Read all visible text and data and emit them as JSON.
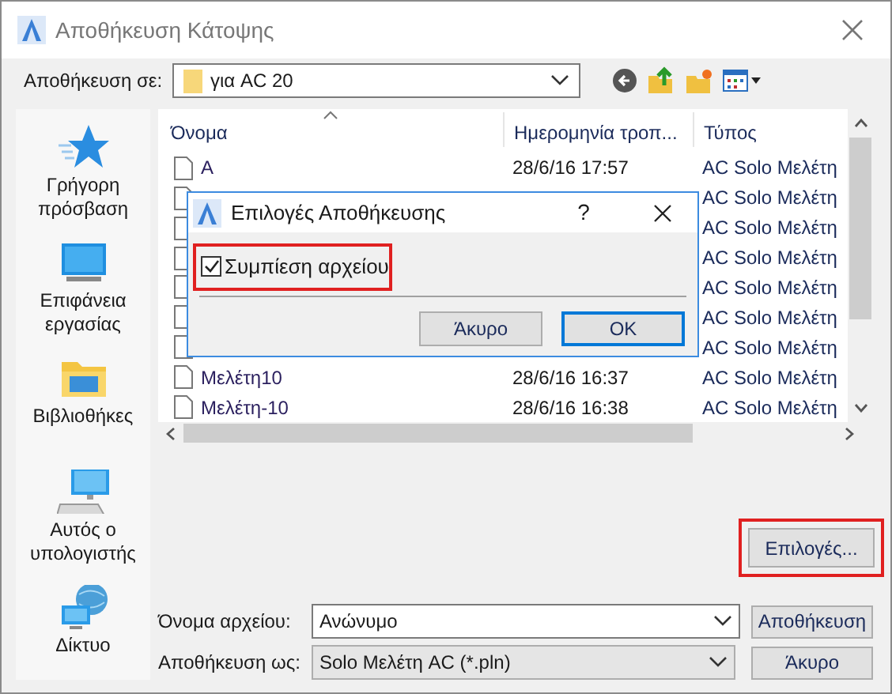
{
  "window": {
    "title": "Αποθήκευση Κάτοψης"
  },
  "location": {
    "label": "Αποθήκευση σε:",
    "value": "για AC 20"
  },
  "sidebar": {
    "items": [
      {
        "label": "Γρήγορη πρόσβαση"
      },
      {
        "label": "Επιφάνεια εργασίας"
      },
      {
        "label": "Βιβλιοθήκες"
      },
      {
        "label": "Αυτός ο υπολογιστής"
      },
      {
        "label": "Δίκτυο"
      }
    ]
  },
  "table": {
    "columns": [
      "Όνομα",
      "Ημερομηνία τροπ...",
      "Τύπος"
    ],
    "rows": [
      {
        "name": "A",
        "date": "28/6/16 17:57",
        "type": "AC Solo Μελέτη"
      },
      {
        "type": "AC Solo Μελέτη"
      },
      {
        "type": "AC Solo Μελέτη"
      },
      {
        "type": "AC Solo Μελέτη"
      },
      {
        "type": "AC Solo Μελέτη"
      },
      {
        "type": "AC Solo Μελέτη"
      },
      {
        "type": "AC Solo Μελέτη"
      },
      {
        "name": "Μελέτη10",
        "date": "28/6/16 16:37",
        "type": "AC Solo Μελέτη"
      },
      {
        "name": "Μελέτη-10",
        "date": "28/6/16 16:38",
        "type": "AC Solo Μελέτη"
      }
    ]
  },
  "options_button": "Επιλογές...",
  "filename": {
    "label": "Όνομα αρχείου:",
    "value": "Ανώνυμο"
  },
  "filetype": {
    "label": "Αποθήκευση ως:",
    "value": "Solo Μελέτη AC (*.pln)"
  },
  "buttons": [
    "Αποθήκευση",
    "Άκυρο"
  ],
  "dialog": {
    "title": "Επιλογές Αποθήκευσης",
    "help": "?",
    "option": {
      "label": "Συμπίεση αρχείου",
      "checked": true
    },
    "buttons": [
      "Άκυρο",
      "OK"
    ]
  }
}
